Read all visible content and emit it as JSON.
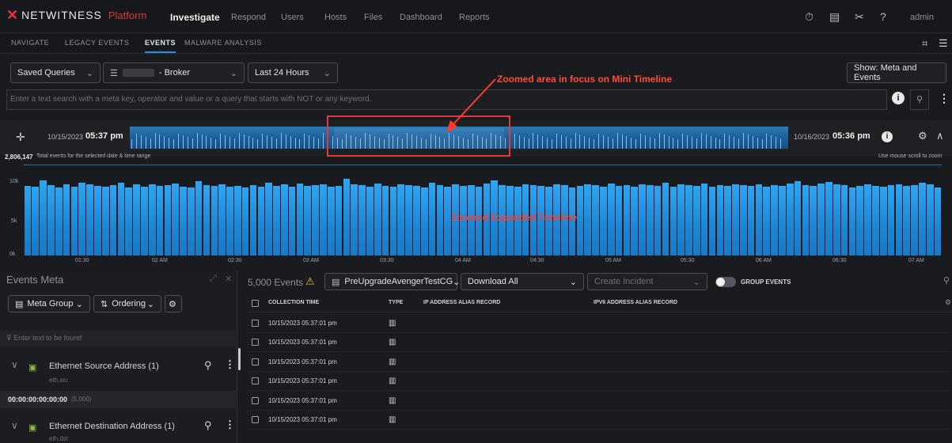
{
  "header": {
    "brand": "NETWITNESS",
    "brand_suffix": "Platform",
    "nav": [
      "Investigate",
      "Respond",
      "Users",
      "Hosts",
      "Files",
      "Dashboard",
      "Reports"
    ],
    "user": "admin"
  },
  "subnav": [
    "NAVIGATE",
    "LEGACY EVENTS",
    "EVENTS",
    "MALWARE ANALYSIS"
  ],
  "toolbar": {
    "saved_queries": "Saved Queries",
    "broker": "- Broker",
    "time_range": "Last 24 Hours",
    "show": "Show: Meta and Events"
  },
  "search": {
    "placeholder": "Enter a text search with a meta key, operator and value or a query that starts with NOT or any keyword."
  },
  "timeline": {
    "start_date": "10/15/2023",
    "start_time": "05:37 pm",
    "end_date": "10/16/2023",
    "end_time": "05:36 pm",
    "total_count": "2,806,147",
    "total_label": "Total events for the selected date & time range",
    "zoom_hint": "Use mouse scroll to zoom",
    "y_labels": [
      "10k",
      "5k",
      "0k"
    ],
    "x_ticks": [
      "01:30",
      "02 AM",
      "02:30",
      "03 AM",
      "03:30",
      "04 AM",
      "04:30",
      "05 AM",
      "05:30",
      "06 AM",
      "06:30",
      "07 AM"
    ]
  },
  "annotations": {
    "mini": "Zoomed area in focus on Mini Timeline",
    "expanded": "Zoomed Expanded  Timeline"
  },
  "chart_data": {
    "type": "bar",
    "title": "",
    "ylim": [
      0,
      12000
    ],
    "values": [
      9200,
      9100,
      9900,
      9300,
      9000,
      9400,
      9100,
      9600,
      9400,
      9200,
      9100,
      9300,
      9600,
      9000,
      9400,
      9100,
      9400,
      9200,
      9300,
      9500,
      9100,
      9000,
      9800,
      9300,
      9200,
      9400,
      9100,
      9200,
      9000,
      9300,
      9100,
      9600,
      9200,
      9400,
      9100,
      9500,
      9200,
      9300,
      9400,
      9100,
      9200,
      10100,
      9400,
      9300,
      9100,
      9500,
      9200,
      9100,
      9400,
      9300,
      9200,
      9000,
      9600,
      9300,
      9100,
      9400,
      9200,
      9300,
      9100,
      9500,
      9900,
      9300,
      9200,
      9100,
      9400,
      9300,
      9200,
      9100,
      9400,
      9300,
      9000,
      9200,
      9400,
      9300,
      9100,
      9500,
      9200,
      9300,
      9100,
      9400,
      9300,
      9200,
      9600,
      9100,
      9400,
      9300,
      9200,
      9500,
      9100,
      9300,
      9200,
      9400,
      9300,
      9200,
      9400,
      9100,
      9300,
      9200,
      9500,
      9800,
      9300,
      9200,
      9500,
      9700,
      9400,
      9300,
      9000,
      9200,
      9400,
      9200,
      9100,
      9300,
      9400,
      9200,
      9300,
      9600,
      9400,
      9000
    ]
  },
  "events_meta": {
    "title": "Events Meta",
    "meta_group": "Meta Group",
    "ordering": "Ordering",
    "filter_placeholder": "Enter text to be found",
    "groups": [
      {
        "label": "Ethernet Source Address (1)",
        "key": "eth.src",
        "value": "00:00:00:00:00:00",
        "count": "(5,000)"
      },
      {
        "label": "Ethernet Destination Address (1)",
        "key": "eth.dst"
      }
    ]
  },
  "events": {
    "count": "5,000 Events",
    "profile": "PreUpgradeAvengerTestCG",
    "download": "Download All",
    "create_incident": "Create Incident",
    "group_events": "GROUP EVENTS",
    "columns": [
      "COLLECTION TIME",
      "TYPE",
      "IP ADDRESS ALIAS RECORD",
      "IPV6 ADDRESS ALIAS RECORD"
    ],
    "rows": [
      "10/15/2023 05:37:01 pm",
      "10/15/2023 05:37:01 pm",
      "10/15/2023 05:37:01 pm",
      "10/15/2023 05:37:01 pm",
      "10/15/2023 05:37:01 pm",
      "10/15/2023 05:37:01 pm"
    ]
  },
  "colors": {
    "accent": "#2b8fe0",
    "bar": "#1b86d6",
    "annotation": "#ff4a3a"
  }
}
